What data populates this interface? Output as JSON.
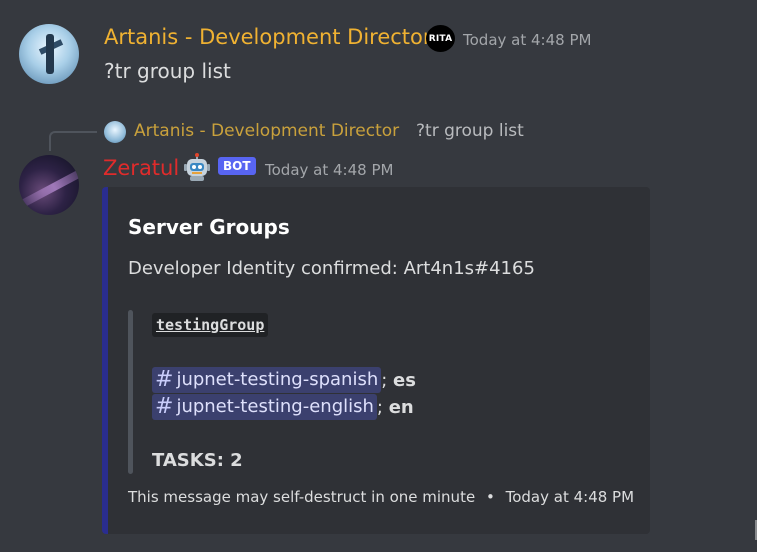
{
  "message1": {
    "author": "Artanis - Development Director",
    "badge": "RITA",
    "timestamp": "Today at 4:48 PM",
    "content": "?tr group list"
  },
  "reply": {
    "author": "Artanis - Development Director",
    "content": "?tr group list"
  },
  "message2": {
    "author": "Zeratul",
    "bot_badge": "BOT",
    "timestamp": "Today at 4:48 PM",
    "embed": {
      "title": "Server Groups",
      "description": "Developer Identity confirmed: Art4n1s#4165",
      "group_name": "testingGroup",
      "channels": [
        {
          "hash": "#",
          "name": "jupnet-testing-spanish",
          "lang": "es"
        },
        {
          "hash": "#",
          "name": "jupnet-testing-english",
          "lang": "en"
        }
      ],
      "tasks": "TASKS: 2",
      "footer_text": "This message may self-destruct in one minute",
      "footer_dot": "•",
      "footer_timestamp": "Today at 4:48 PM",
      "accent_color": "#2a2d8f"
    }
  },
  "colors": {
    "background": "#36393f",
    "embed_bg": "#2f3136",
    "artanis_name": "#f0b232",
    "zeratul_name": "#e02b2b",
    "bot_badge": "#5865f2"
  }
}
